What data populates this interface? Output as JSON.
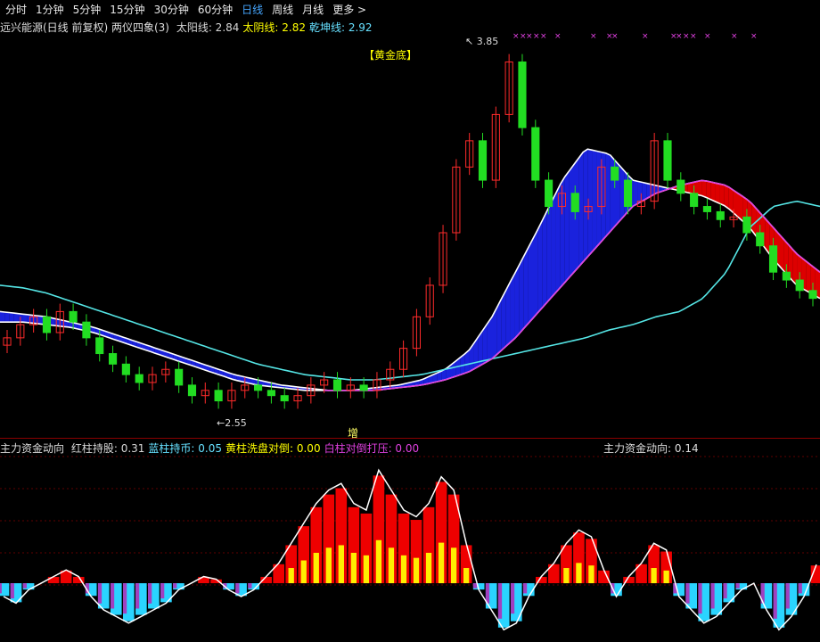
{
  "toolbar": {
    "tabs": [
      "分时",
      "1分钟",
      "5分钟",
      "15分钟",
      "30分钟",
      "60分钟",
      "日线",
      "周线",
      "月线",
      "更多 >"
    ],
    "active": "日线"
  },
  "main_panel": {
    "title": "远兴能源(日线 前复权) 两仪四象(3)",
    "indicators": [
      {
        "label": "太阳线:",
        "value": "2.84",
        "color": "#d7d7d7"
      },
      {
        "label": "太阴线:",
        "value": "2.82",
        "color": "#ffff00"
      },
      {
        "label": "乾坤线:",
        "value": "2.92",
        "color": "#66e0ff"
      }
    ],
    "annotation_gold": "【黄金底】",
    "annotation_zeng": "增",
    "colors": {
      "up": "#ff2b2b",
      "down": "#22dd22",
      "ribbon_bull": "#dd0000",
      "ribbon_bear": "#1a22dd",
      "cyan_line": "#55e6e6",
      "magenta_line": "#e040e0",
      "white_line": "#ffffff"
    }
  },
  "sub_panel": {
    "title": "主力资金动向",
    "indicators": [
      {
        "label": "红柱持股:",
        "value": "0.31",
        "color": "#d7d7d7"
      },
      {
        "label": "蓝柱持币:",
        "value": "0.05",
        "color": "#66e0ff"
      },
      {
        "label": "黄柱洗盘对倒:",
        "value": "0.00",
        "color": "#ffff00"
      },
      {
        "label": "白柱对倒打压:",
        "value": "0.00",
        "color": "#e040e0"
      }
    ],
    "right_label": "主力资金动向:",
    "right_value": "0.14"
  },
  "chart_data": {
    "type": "line",
    "title": "远兴能源(日线 前复权) 两仪四象(3)",
    "xlabel": "",
    "ylabel": "",
    "ylim": [
      2.45,
      3.95
    ],
    "max_price": "3.85",
    "min_price": "2.55",
    "price_close_approx": [
      2.8,
      2.85,
      2.88,
      2.82,
      2.9,
      2.86,
      2.8,
      2.74,
      2.7,
      2.66,
      2.63,
      2.66,
      2.68,
      2.62,
      2.58,
      2.6,
      2.56,
      2.6,
      2.62,
      2.6,
      2.58,
      2.56,
      2.58,
      2.62,
      2.64,
      2.6,
      2.62,
      2.6,
      2.64,
      2.68,
      2.76,
      2.88,
      3.0,
      3.2,
      3.45,
      3.55,
      3.4,
      3.65,
      3.85,
      3.6,
      3.4,
      3.3,
      3.35,
      3.28,
      3.3,
      3.45,
      3.4,
      3.3,
      3.32,
      3.55,
      3.4,
      3.35,
      3.3,
      3.28,
      3.25,
      3.26,
      3.2,
      3.15,
      3.05,
      3.02,
      2.98,
      2.95
    ],
    "series": [
      {
        "name": "太阳线",
        "values": [
          2.9,
          2.89,
          2.88,
          2.86,
          2.84,
          2.81,
          2.78,
          2.75,
          2.72,
          2.69,
          2.66,
          2.64,
          2.62,
          2.61,
          2.6,
          2.6,
          2.61,
          2.62,
          2.64,
          2.68,
          2.75,
          2.88,
          3.05,
          3.22,
          3.4,
          3.52,
          3.5,
          3.4,
          3.38,
          3.36,
          3.34,
          3.3,
          3.22,
          3.1,
          3.0,
          2.95
        ]
      },
      {
        "name": "太阴线",
        "values": [
          2.86,
          2.86,
          2.85,
          2.84,
          2.82,
          2.79,
          2.76,
          2.73,
          2.7,
          2.67,
          2.64,
          2.62,
          2.61,
          2.6,
          2.6,
          2.6,
          2.6,
          2.61,
          2.62,
          2.64,
          2.67,
          2.72,
          2.8,
          2.9,
          3.0,
          3.1,
          3.2,
          3.3,
          3.35,
          3.38,
          3.4,
          3.38,
          3.32,
          3.22,
          3.12,
          3.05
        ]
      },
      {
        "name": "乾坤线",
        "values": [
          3.0,
          2.99,
          2.97,
          2.94,
          2.91,
          2.88,
          2.85,
          2.82,
          2.79,
          2.76,
          2.73,
          2.7,
          2.68,
          2.66,
          2.65,
          2.64,
          2.64,
          2.65,
          2.66,
          2.68,
          2.7,
          2.72,
          2.74,
          2.76,
          2.78,
          2.8,
          2.83,
          2.85,
          2.88,
          2.9,
          2.95,
          3.05,
          3.22,
          3.3,
          3.32,
          3.3
        ]
      }
    ],
    "sub_chart": {
      "ylim": [
        -0.45,
        1.0
      ],
      "values_approx": [
        -0.1,
        -0.15,
        -0.05,
        0.0,
        0.05,
        0.1,
        0.05,
        -0.1,
        -0.2,
        -0.25,
        -0.3,
        -0.25,
        -0.2,
        -0.15,
        -0.05,
        0.0,
        0.05,
        0.03,
        -0.05,
        -0.1,
        -0.05,
        0.05,
        0.15,
        0.3,
        0.45,
        0.6,
        0.7,
        0.75,
        0.6,
        0.55,
        0.85,
        0.7,
        0.55,
        0.5,
        0.6,
        0.8,
        0.7,
        0.3,
        -0.05,
        -0.2,
        -0.35,
        -0.3,
        -0.1,
        0.05,
        0.15,
        0.3,
        0.4,
        0.35,
        0.1,
        -0.1,
        0.05,
        0.15,
        0.3,
        0.25,
        -0.1,
        -0.2,
        -0.3,
        -0.25,
        -0.15,
        -0.05,
        0.0,
        -0.2,
        -0.35,
        -0.25,
        -0.1,
        0.14
      ]
    }
  }
}
